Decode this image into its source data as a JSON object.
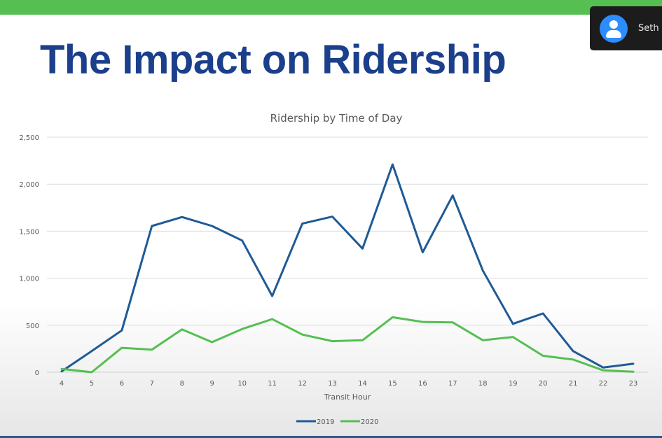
{
  "slide": {
    "title": "The Impact on Ridership"
  },
  "participant": {
    "name": "Seth",
    "avatar_icon": "user-avatar-icon"
  },
  "colors": {
    "top_bar": "#55bf52",
    "title": "#1b3f8b",
    "series_2019": "#1f5a96",
    "series_2020": "#55bf52"
  },
  "chart_data": {
    "type": "line",
    "title": "Ridership by Time of Day",
    "xlabel": "Transit Hour",
    "ylabel": "",
    "x": [
      "4",
      "5",
      "6",
      "7",
      "8",
      "9",
      "10",
      "11",
      "12",
      "13",
      "14",
      "15",
      "16",
      "17",
      "18",
      "19",
      "20",
      "21",
      "22",
      "23"
    ],
    "ylim": [
      0,
      2500
    ],
    "yticks": [
      0,
      500,
      1000,
      1500,
      2000,
      2500
    ],
    "ytick_labels": [
      "0",
      "500",
      "1,000",
      "1,500",
      "2,000",
      "2,500"
    ],
    "grid": true,
    "legend_position": "bottom",
    "series": [
      {
        "name": "2019",
        "color": "#1f5a96",
        "values": [
          10,
          225,
          445,
          1555,
          1650,
          1555,
          1400,
          810,
          1580,
          1655,
          1315,
          2210,
          1275,
          1880,
          1080,
          515,
          625,
          225,
          50,
          90
        ]
      },
      {
        "name": "2020",
        "color": "#55bf52",
        "values": [
          35,
          0,
          260,
          240,
          455,
          320,
          460,
          565,
          400,
          330,
          340,
          585,
          535,
          530,
          340,
          375,
          175,
          135,
          20,
          5
        ]
      }
    ]
  }
}
